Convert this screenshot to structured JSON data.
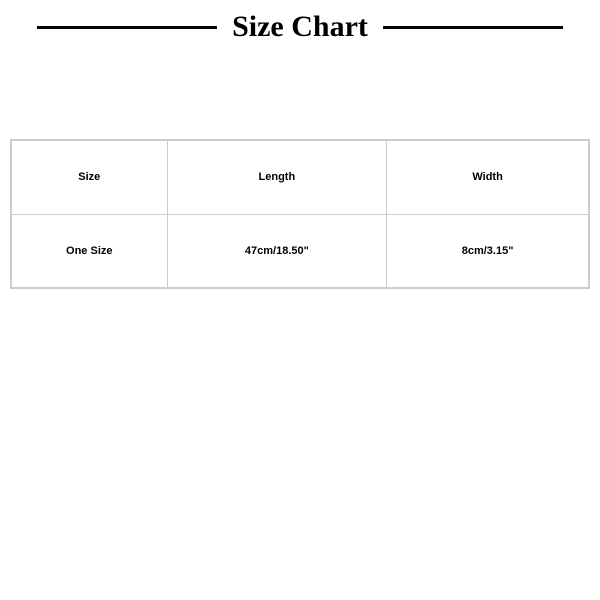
{
  "header": {
    "title": "Size Chart"
  },
  "table": {
    "headers": [
      "Size",
      "Length",
      "Width"
    ],
    "rows": [
      [
        "One Size",
        "47cm/18.50\"",
        "8cm/3.15\""
      ]
    ]
  }
}
